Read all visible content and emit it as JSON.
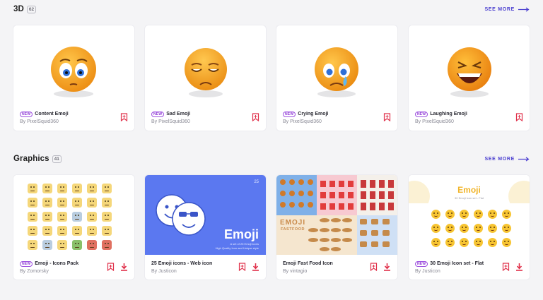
{
  "sections": [
    {
      "title": "3D",
      "count": "62",
      "see_more": "SEE MORE",
      "cards": [
        {
          "badge": "NEW",
          "title": "Content Emoji",
          "author": "By PixelSquid360"
        },
        {
          "badge": "NEW",
          "title": "Sad Emoji",
          "author": "By PixelSquid360"
        },
        {
          "badge": "NEW",
          "title": "Crying Emoji",
          "author": "By PixelSquid360"
        },
        {
          "badge": "NEW",
          "title": "Laughing Emoji",
          "author": "By PixelSquid360"
        }
      ]
    },
    {
      "title": "Graphics",
      "count": "41",
      "see_more": "SEE MORE",
      "cards": [
        {
          "badge": "NEW",
          "title": "Emoji - Icons Pack",
          "author": "By Zomorsky"
        },
        {
          "badge": "",
          "title": "25 Emoji icons - Web icon",
          "author": "By Justicon"
        },
        {
          "badge": "",
          "title": "Emoji Fast Food Icon",
          "author": "By vintagio"
        },
        {
          "badge": "NEW",
          "title": "30 Emoji Icon set - Flat",
          "author": "By Justicon"
        }
      ]
    }
  ],
  "thumb_text": {
    "webicon_number": "25",
    "webicon_title": "Emoji",
    "webicon_sub1": "A set of 25 Emoji icons",
    "webicon_sub2": "High Quality Icon and Unique style",
    "fastfood_title": "EMOJI",
    "fastfood_sub": "FASTFOOD",
    "flat_title": "Emoji",
    "flat_sub": "30 Emoji Icon set - Flat"
  },
  "colors": {
    "accent": "#4b3fd0",
    "new_badge": "#9d4fe0",
    "action_red": "#e0304a",
    "emoji_orange": "#f5a623",
    "webicon_blue": "#5b78f0"
  },
  "icons": {
    "see_more": "arrow-right-icon",
    "bookmark": "bookmark-icon",
    "download": "download-icon"
  }
}
